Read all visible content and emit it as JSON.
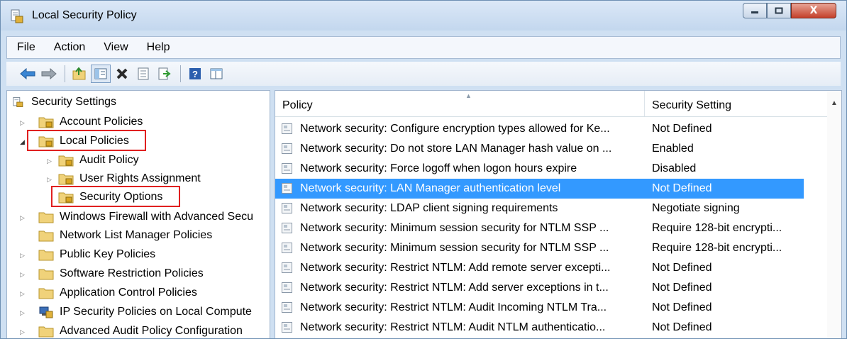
{
  "window": {
    "title": "Local Security Policy",
    "close_glyph": "X"
  },
  "menu": [
    "File",
    "Action",
    "View",
    "Help"
  ],
  "toolbar": {
    "icons": [
      "back-icon",
      "forward-icon",
      "up-folder-icon",
      "show-hide-tree-icon",
      "delete-icon",
      "properties-icon",
      "export-list-icon",
      "help-icon",
      "view-icon"
    ],
    "help_glyph": "?"
  },
  "tree": {
    "root": "Security Settings",
    "items": [
      {
        "label": "Account Policies"
      },
      {
        "label": "Local Policies"
      },
      {
        "label": "Audit Policy"
      },
      {
        "label": "User Rights Assignment"
      },
      {
        "label": "Security Options"
      },
      {
        "label": "Windows Firewall with Advanced Secu"
      },
      {
        "label": "Network List Manager Policies"
      },
      {
        "label": "Public Key Policies"
      },
      {
        "label": "Software Restriction Policies"
      },
      {
        "label": "Application Control Policies"
      },
      {
        "label": "IP Security Policies on Local Compute"
      },
      {
        "label": "Advanced Audit Policy Configuration"
      }
    ]
  },
  "list": {
    "columns": [
      "Policy",
      "Security Setting"
    ],
    "rows": [
      {
        "policy": "Network security: Configure encryption types allowed for Ke...",
        "setting": "Not Defined"
      },
      {
        "policy": "Network security: Do not store LAN Manager hash value on ...",
        "setting": "Enabled"
      },
      {
        "policy": "Network security: Force logoff when logon hours expire",
        "setting": "Disabled"
      },
      {
        "policy": "Network security: LAN Manager authentication level",
        "setting": "Not Defined"
      },
      {
        "policy": "Network security: LDAP client signing requirements",
        "setting": "Negotiate signing"
      },
      {
        "policy": "Network security: Minimum session security for NTLM SSP ...",
        "setting": "Require 128-bit encrypti..."
      },
      {
        "policy": "Network security: Minimum session security for NTLM SSP ...",
        "setting": "Require 128-bit encrypti..."
      },
      {
        "policy": "Network security: Restrict NTLM: Add remote server excepti...",
        "setting": "Not Defined"
      },
      {
        "policy": "Network security: Restrict NTLM: Add server exceptions in t...",
        "setting": "Not Defined"
      },
      {
        "policy": "Network security: Restrict NTLM: Audit Incoming NTLM Tra...",
        "setting": "Not Defined"
      },
      {
        "policy": "Network security: Restrict NTLM: Audit NTLM authenticatio...",
        "setting": "Not Defined"
      }
    ]
  },
  "colors": {
    "selection": "#3399ff",
    "highlight_box": "#e02020",
    "folder": "#f0d27a"
  }
}
